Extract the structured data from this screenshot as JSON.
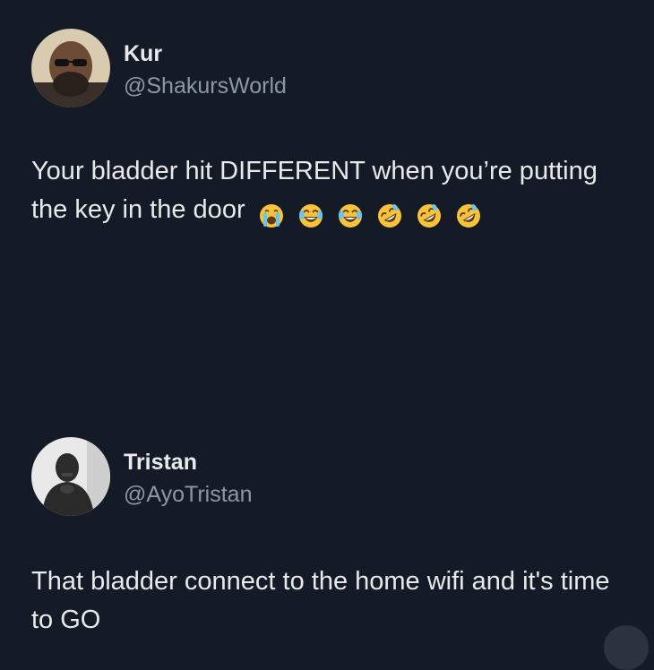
{
  "posts": [
    {
      "display_name": "Kur",
      "handle": "@ShakursWorld",
      "text": "Your bladder hit DIFFERENT when you’re putting the key in the door",
      "emojis": [
        "loudly-crying-face",
        "face-with-tears-of-joy",
        "face-with-tears-of-joy",
        "rolling-on-floor-laughing",
        "rolling-on-floor-laughing",
        "rolling-on-floor-laughing"
      ]
    },
    {
      "display_name": "Tristan",
      "handle": "@AyoTristan",
      "text": "That bladder connect to the home wifi and it's time to GO"
    }
  ],
  "colors": {
    "background": "#151b26",
    "text": "#e7e9ea",
    "handle": "#8b98a5",
    "emoji": "#f7c33b"
  }
}
